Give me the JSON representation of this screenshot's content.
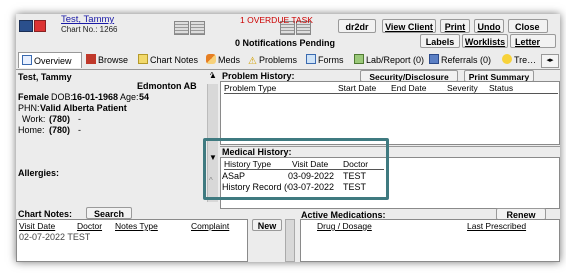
{
  "header": {
    "patient_name": "Test, Tammy",
    "chart_no": "Chart No.: 1266",
    "overdue_task": "1 OVERDUE TASK",
    "notifications": "0 Notifications Pending",
    "buttons": {
      "dr2dr": "dr2dr",
      "view_client": "View Client",
      "print": "Print",
      "undo": "Undo",
      "close": "Close",
      "labels": "Labels",
      "worklists": "Worklists",
      "letters": "Letter"
    }
  },
  "tabs": [
    {
      "label": "Overview",
      "icon": "overview-icon"
    },
    {
      "label": "Browse",
      "icon": "book-icon"
    },
    {
      "label": "Chart Notes",
      "icon": "notes-icon"
    },
    {
      "label": "Meds",
      "icon": "pill-icon"
    },
    {
      "label": "Problems",
      "icon": "warning-icon"
    },
    {
      "label": "Forms",
      "icon": "form-icon"
    },
    {
      "label": "Lab/Report (0)",
      "icon": "lab-icon"
    },
    {
      "label": "Referrals (0)",
      "icon": "referral-icon"
    },
    {
      "label": "Tre",
      "icon": "smiley-icon"
    }
  ],
  "patient": {
    "name": "Test, Tammy",
    "location": "Edmonton  AB",
    "sex": "Female",
    "dob_label": "DOB:",
    "dob": "16-01-1968",
    "age_label": "Age:",
    "age": "54",
    "phn_label": "PHN:",
    "phn": "Valid Alberta Patient",
    "work_label": "Work:",
    "work": "(780)",
    "work_ext": "-",
    "home_label": "Home:",
    "home": "(780)",
    "home_ext": "-",
    "allergies_label": "Allergies:"
  },
  "problem_history": {
    "title": "Problem History:",
    "security_button": "Security/Disclosure Log",
    "print_summary_button": "Print Summary",
    "columns": [
      "Problem Type",
      "Start Date",
      "End Date",
      "Severity",
      "Status"
    ]
  },
  "medical_history": {
    "title": "Medical History:",
    "columns": [
      "History Type",
      "Visit Date",
      "Doctor"
    ],
    "rows": [
      {
        "type": "ASaP",
        "date": "03-09-2022",
        "doctor": "TEST"
      },
      {
        "type": "History Record (C",
        "date": "03-07-2022",
        "doctor": "TEST"
      }
    ]
  },
  "chart_notes": {
    "title": "Chart Notes:",
    "search_button": "Search",
    "new_button": "New",
    "columns": [
      "Visit Date",
      "Doctor",
      "Notes Type",
      "Complaint"
    ],
    "partial_row": "02-07-2022  TEST"
  },
  "active_medications": {
    "title": "Active Medications:",
    "renew_button": "Renew",
    "columns": [
      "Drug / Dosage",
      "Last Prescribed"
    ]
  },
  "colors": {
    "highlight_border": "#3f7a80",
    "link_blue": "#1a1aa6",
    "overdue_red": "#cc0000"
  }
}
